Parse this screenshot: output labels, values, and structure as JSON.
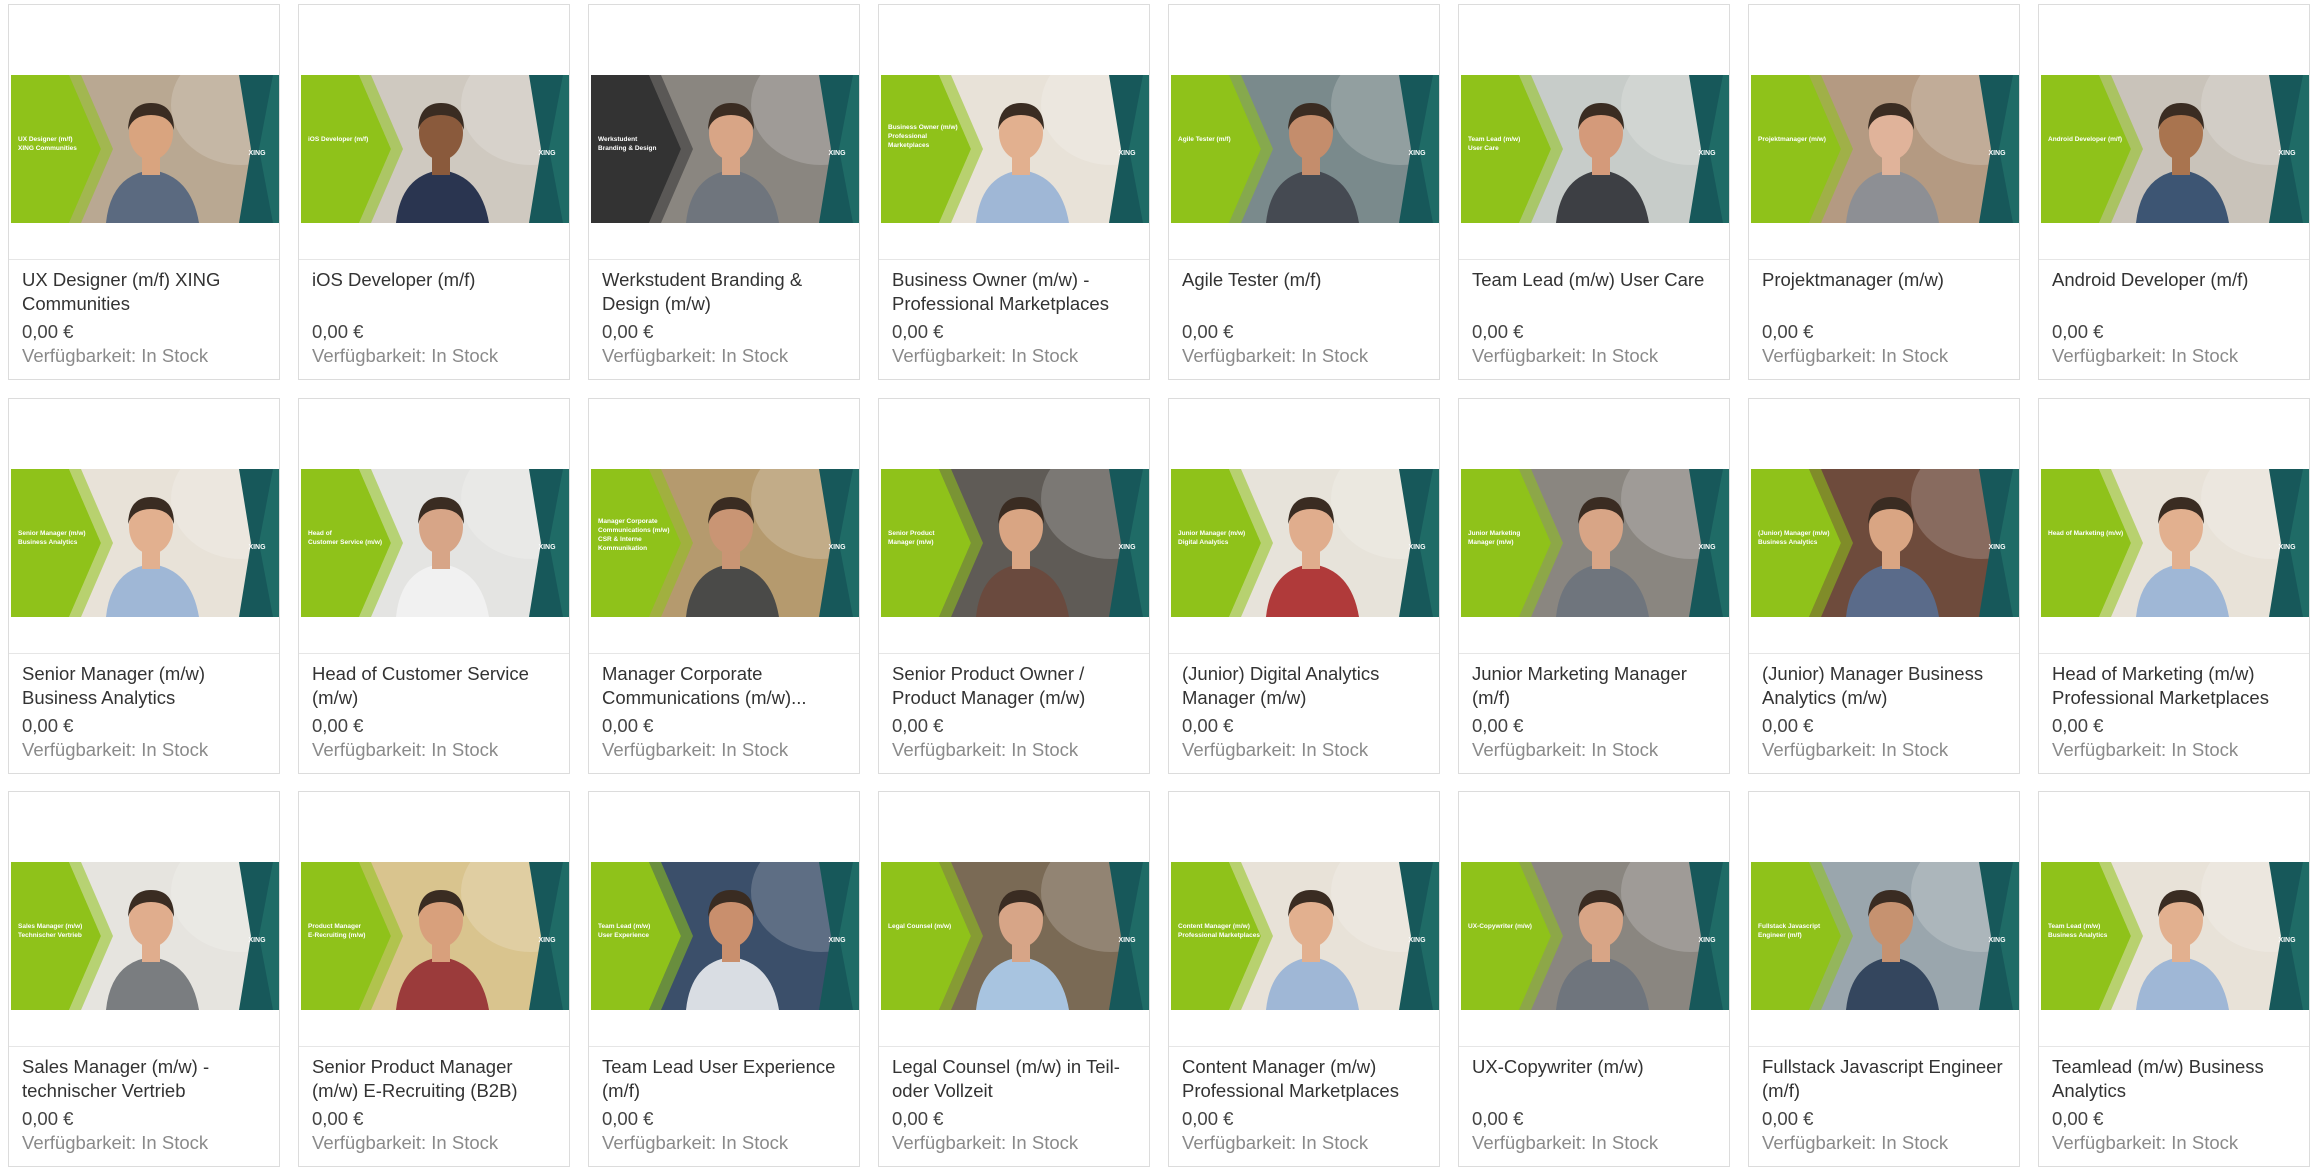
{
  "products": [
    {
      "title": "UX Designer (m/f) XING Communities",
      "price": "0,00 €",
      "availability": "Verfügbarkeit: In Stock",
      "banner": "UX Designer (m/f)\nXING Communities",
      "left_color": "#8fc21a",
      "photo_bg": "#b9a892",
      "skin": "#d9a47f",
      "shirt": "#5b6a80",
      "dark": false
    },
    {
      "title": "iOS Developer (m/f)",
      "price": "0,00 €",
      "availability": "Verfügbarkeit: In Stock",
      "banner": "iOS Developer (m/f)",
      "left_color": "#8fc21a",
      "photo_bg": "#cfc9c0",
      "skin": "#8a5a3c",
      "shirt": "#2a3550",
      "dark": false
    },
    {
      "title": "Werkstudent Branding & Design (m/w)",
      "price": "0,00 €",
      "availability": "Verfügbarkeit: In Stock",
      "banner": "Werkstudent\nBranding & Design",
      "left_color": "#333333",
      "photo_bg": "#8a8680",
      "skin": "#d8a586",
      "shirt": "#6f757d",
      "dark": true
    },
    {
      "title": "Business Owner (m/w) - Professional Marketplaces",
      "price": "0,00 €",
      "availability": "Verfügbarkeit: In Stock",
      "banner": "Business Owner (m/w)\nProfessional\nMarketplaces",
      "left_color": "#8fc21a",
      "photo_bg": "#e8e2d8",
      "skin": "#e2b08f",
      "shirt": "#9fb7d6",
      "dark": false
    },
    {
      "title": "Agile Tester (m/f)",
      "price": "0,00 €",
      "availability": "Verfügbarkeit: In Stock",
      "banner": "Agile Tester (m/f)",
      "left_color": "#8fc21a",
      "photo_bg": "#7a8a8c",
      "skin": "#c48d6c",
      "shirt": "#454a52",
      "dark": false
    },
    {
      "title": "Team Lead (m/w) User Care",
      "price": "0,00 €",
      "availability": "Verfügbarkeit: In Stock",
      "banner": "Team Lead (m/w)\nUser Care",
      "left_color": "#8fc21a",
      "photo_bg": "#c7ccc9",
      "skin": "#d49a7a",
      "shirt": "#3d3f44",
      "dark": false
    },
    {
      "title": "Projektmanager (m/w)",
      "price": "0,00 €",
      "availability": "Verfügbarkeit: In Stock",
      "banner": "Projektmanager (m/w)",
      "left_color": "#8fc21a",
      "photo_bg": "#b49a82",
      "skin": "#e0b39a",
      "shirt": "#8d8f94",
      "dark": false
    },
    {
      "title": "Android Developer (m/f)",
      "price": "0,00 €",
      "availability": "Verfügbarkeit: In Stock",
      "banner": "Android Developer (m/f)",
      "left_color": "#8fc21a",
      "photo_bg": "#c9c3ba",
      "skin": "#a9744f",
      "shirt": "#3d5573",
      "dark": false
    },
    {
      "title": "Senior Manager (m/w) Business Analytics",
      "price": "0,00 €",
      "availability": "Verfügbarkeit: In Stock",
      "banner": "Senior Manager (m/w)\nBusiness Analytics",
      "left_color": "#8fc21a",
      "photo_bg": "#e8e2d8",
      "skin": "#e2b08f",
      "shirt": "#9fb7d6",
      "dark": false
    },
    {
      "title": "Head of Customer Service (m/w)",
      "price": "0,00 €",
      "availability": "Verfügbarkeit: In Stock",
      "banner": "Head of\nCustomer Service (m/w)",
      "left_color": "#8fc21a",
      "photo_bg": "#e4e4e2",
      "skin": "#d7a587",
      "shirt": "#f1f1f1",
      "dark": false
    },
    {
      "title": "Manager Corporate Communications (m/w)...",
      "price": "0,00 €",
      "availability": "Verfügbarkeit: In Stock",
      "banner": "Manager Corporate\nCommunications (m/w)\nCSR & Interne\nKommunikation",
      "left_color": "#8fc21a",
      "photo_bg": "#b59a6e",
      "skin": "#c99574",
      "shirt": "#4a4a48",
      "dark": false
    },
    {
      "title": "Senior Product Owner / Product Manager (m/w)",
      "price": "0,00 €",
      "availability": "Verfügbarkeit: In Stock",
      "banner": "Senior Product\nManager (m/w)",
      "left_color": "#8fc21a",
      "photo_bg": "#5f5b56",
      "skin": "#d9a583",
      "shirt": "#6a4a3e",
      "dark": false
    },
    {
      "title": "(Junior) Digital Analytics Manager (m/w)",
      "price": "0,00 €",
      "availability": "Verfügbarkeit: In Stock",
      "banner": "Junior Manager (m/w)\nDigital Analytics",
      "left_color": "#8fc21a",
      "photo_bg": "#e7e3da",
      "skin": "#e0ad8d",
      "shirt": "#b03a3a",
      "dark": false
    },
    {
      "title": "Junior Marketing Manager (m/f)",
      "price": "0,00 €",
      "availability": "Verfügbarkeit: In Stock",
      "banner": "Junior Marketing\nManager (m/w)",
      "left_color": "#8fc21a",
      "photo_bg": "#8a8680",
      "skin": "#d8a586",
      "shirt": "#6f757d",
      "dark": false
    },
    {
      "title": "(Junior) Manager Business Analytics (m/w)",
      "price": "0,00 €",
      "availability": "Verfügbarkeit: In Stock",
      "banner": "(Junior) Manager (m/w)\nBusiness Analytics",
      "left_color": "#8fc21a",
      "photo_bg": "#6e4b3c",
      "skin": "#d9a583",
      "shirt": "#5a6b8a",
      "dark": false
    },
    {
      "title": "Head of Marketing (m/w) Professional Marketplaces",
      "price": "0,00 €",
      "availability": "Verfügbarkeit: In Stock",
      "banner": "Head of Marketing (m/w)",
      "left_color": "#8fc21a",
      "photo_bg": "#e8e2d8",
      "skin": "#e2b08f",
      "shirt": "#9fb7d6",
      "dark": false
    },
    {
      "title": "Sales Manager (m/w) - technischer Vertrieb",
      "price": "0,00 €",
      "availability": "Verfügbarkeit: In Stock",
      "banner": "Sales Manager (m/w)\nTechnischer Vertrieb",
      "left_color": "#8fc21a",
      "photo_bg": "#e6e4df",
      "skin": "#e0ad8d",
      "shirt": "#7a7d80",
      "dark": false
    },
    {
      "title": "Senior Product Manager (m/w) E-Recruiting (B2B)",
      "price": "0,00 €",
      "availability": "Verfügbarkeit: In Stock",
      "banner": "Product Manager\nE-Recruiting (m/w)",
      "left_color": "#8fc21a",
      "photo_bg": "#d9c48e",
      "skin": "#d8a07c",
      "shirt": "#9b3b3b",
      "dark": false
    },
    {
      "title": "Team Lead User Experience (m/f)",
      "price": "0,00 €",
      "availability": "Verfügbarkeit: In Stock",
      "banner": "Team Lead (m/w)\nUser Experience",
      "left_color": "#8fc21a",
      "photo_bg": "#3b4f6a",
      "skin": "#c98f6d",
      "shirt": "#d9dde3",
      "dark": false
    },
    {
      "title": "Legal Counsel (m/w) in Teil- oder Vollzeit",
      "price": "0,00 €",
      "availability": "Verfügbarkeit: In Stock",
      "banner": "Legal Counsel (m/w)",
      "left_color": "#8fc21a",
      "photo_bg": "#7a6a55",
      "skin": "#d7a587",
      "shirt": "#a8c4e0",
      "dark": false
    },
    {
      "title": "Content Manager (m/w) Professional Marketplaces",
      "price": "0,00 €",
      "availability": "Verfügbarkeit: In Stock",
      "banner": "Content Manager (m/w)\nProfessional Marketplaces",
      "left_color": "#8fc21a",
      "photo_bg": "#e8e2d8",
      "skin": "#e2b08f",
      "shirt": "#9fb7d6",
      "dark": false
    },
    {
      "title": "UX-Copywriter (m/w)",
      "price": "0,00 €",
      "availability": "Verfügbarkeit: In Stock",
      "banner": "UX-Copywriter (m/w)",
      "left_color": "#8fc21a",
      "photo_bg": "#8a8680",
      "skin": "#d8a586",
      "shirt": "#6f757d",
      "dark": false
    },
    {
      "title": "Fullstack Javascript Engineer (m/f)",
      "price": "0,00 €",
      "availability": "Verfügbarkeit: In Stock",
      "banner": "Fullstack Javascript\nEngineer (m/f)",
      "left_color": "#8fc21a",
      "photo_bg": "#9aa6ad",
      "skin": "#c69270",
      "shirt": "#34465e",
      "dark": false
    },
    {
      "title": "Teamlead (m/w) Business Analytics",
      "price": "0,00 €",
      "availability": "Verfügbarkeit: In Stock",
      "banner": "Team Lead (m/w)\nBusiness Analytics",
      "left_color": "#8fc21a",
      "photo_bg": "#e8e2d8",
      "skin": "#e2b08f",
      "shirt": "#9fb7d6",
      "dark": false
    }
  ],
  "xing_logo_text": "XING",
  "colors": {
    "green": "#8fc21a",
    "teal": "#1f6b66",
    "teal_dark": "#17585a"
  }
}
